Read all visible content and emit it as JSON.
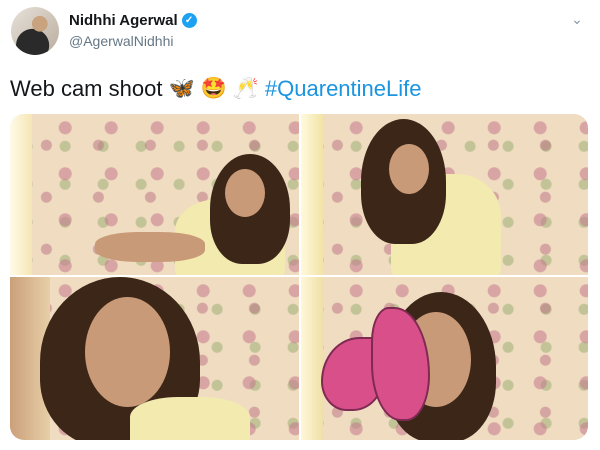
{
  "user": {
    "name": "Nidhhi Agerwal",
    "handle": "@AgerwalNidhhi",
    "verified_icon": "verified-badge-icon",
    "menu_icon": "chevron-down-icon"
  },
  "tweet": {
    "text": "Web cam shoot",
    "emojis": [
      "🦋",
      "🤩",
      "🥂"
    ],
    "hashtag": "#QuarentineLife"
  },
  "colors": {
    "link": "#1b95e0",
    "verified": "#1da1f2",
    "secondary_text": "#657786"
  },
  "media": {
    "count": 4
  }
}
